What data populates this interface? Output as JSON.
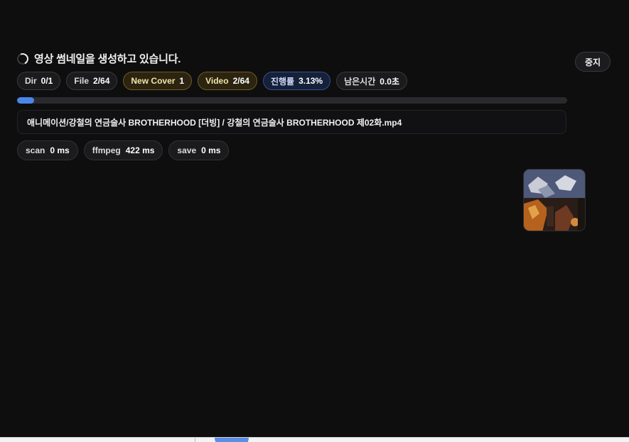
{
  "status": {
    "message": "영상 썸네일을 생성하고 있습니다."
  },
  "controls": {
    "stop_label": "중지"
  },
  "counters": {
    "dir": {
      "label": "Dir",
      "value": "0/1"
    },
    "file": {
      "label": "File",
      "value": "2/64"
    },
    "new_cover": {
      "label": "New Cover",
      "value": "1"
    },
    "video": {
      "label": "Video",
      "value": "2/64"
    },
    "progress": {
      "label": "진행률",
      "value": "3.13%"
    },
    "remaining": {
      "label": "남은시간",
      "value": "0.0초"
    }
  },
  "progress": {
    "fraction": 0.0313
  },
  "current_file": {
    "path": "애니메이션/강철의 연금술사 BROTHERHOOD [더빙] / 강철의 연금술사 BROTHERHOOD 제02화.mp4"
  },
  "timings": {
    "scan": {
      "label": "scan",
      "value": "0 ms"
    },
    "ffmpeg": {
      "label": "ffmpeg",
      "value": "422 ms"
    },
    "save": {
      "label": "save",
      "value": "0 ms"
    }
  },
  "thumbnail": {
    "icon": "video-thumbnail-image"
  },
  "colors": {
    "accent": "#4a86e8",
    "background": "#0e0e0f",
    "gold_chip": "#2c2410",
    "blue_chip": "#15203a"
  }
}
